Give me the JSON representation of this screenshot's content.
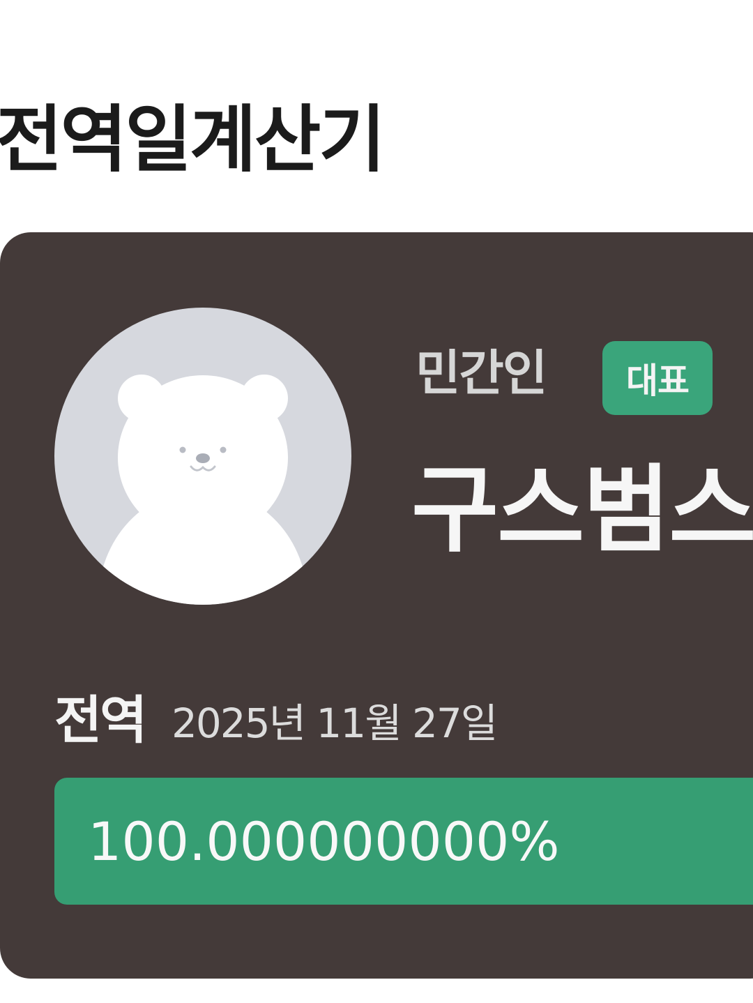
{
  "page": {
    "title": "전역일계산기"
  },
  "profile": {
    "role": "민간인",
    "badge": "대표",
    "name": "구스범스",
    "avatar_icon": "bear-avatar-icon"
  },
  "discharge": {
    "label": "전역",
    "date": "2025년 11월 27일"
  },
  "progress": {
    "text": "100.000000000%",
    "fraction": 1.0
  },
  "colors": {
    "card_background": "#443a39",
    "accent_green": "#369e73",
    "badge_green": "#3aa57b",
    "avatar_background": "#d6d8de"
  }
}
